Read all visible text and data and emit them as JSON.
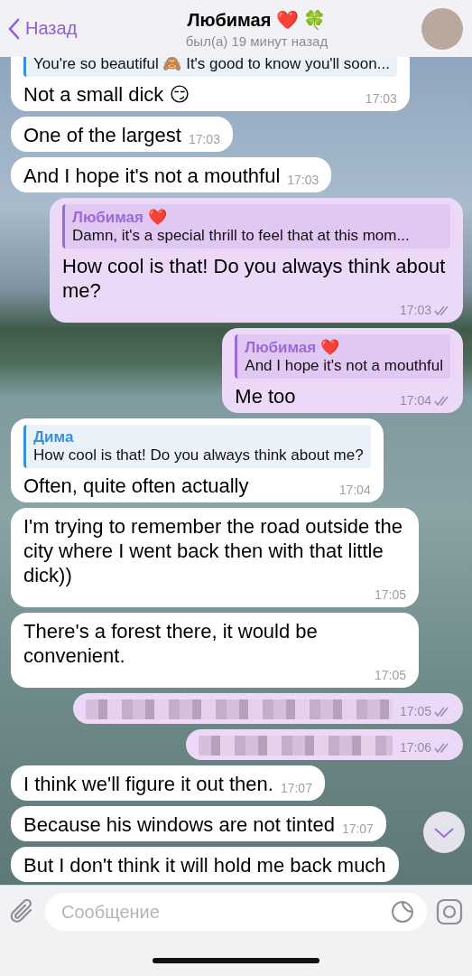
{
  "header": {
    "back": "Назад",
    "title": "Любимая ❤️ 🍀",
    "status": "был(а) 19 минут назад"
  },
  "messages": [
    {
      "kind": "incoming",
      "reply": {
        "text": "You're so beautiful 🙈 It's good to know you'll soon..."
      },
      "text": "Not a small dick 😏",
      "time": "17:03"
    },
    {
      "kind": "incoming",
      "text": "One of the largest",
      "time": "17:03"
    },
    {
      "kind": "incoming",
      "text": "And I hope it's not a mouthful",
      "time": "17:03"
    },
    {
      "kind": "outgoing",
      "reply": {
        "author": "Любимая ❤️",
        "text": "Damn, it's a special thrill to feel that at this mom..."
      },
      "text": "How cool is that! Do you always think about me?",
      "time": "17:03",
      "read": true
    },
    {
      "kind": "outgoing",
      "reply": {
        "author": "Любимая ❤️",
        "text": "And I hope it's not a mouthful"
      },
      "text": "Me too",
      "time": "17:04",
      "read": true
    },
    {
      "kind": "incoming",
      "reply": {
        "author": "Дима",
        "text": "How cool is that!  Do you always think about me?"
      },
      "text": "Often, quite often actually",
      "time": "17:04"
    },
    {
      "kind": "incoming",
      "text": "I'm trying to remember the road outside the city where I went back then with that little dick))",
      "time": "17:05"
    },
    {
      "kind": "incoming",
      "text": "There's a forest there, it would be convenient.",
      "time": "17:05"
    },
    {
      "kind": "blurred",
      "time": "17:05",
      "read": true
    },
    {
      "kind": "blurred",
      "time": "17:06",
      "read": true
    },
    {
      "kind": "incoming",
      "text": "I think we'll figure it out then.",
      "time": "17:07"
    },
    {
      "kind": "incoming",
      "text": "Because his windows are not tinted",
      "time": "17:07"
    },
    {
      "kind": "incoming",
      "text": "But I don't think it will hold me back much"
    }
  ],
  "input": {
    "placeholder": "Сообщение"
  }
}
